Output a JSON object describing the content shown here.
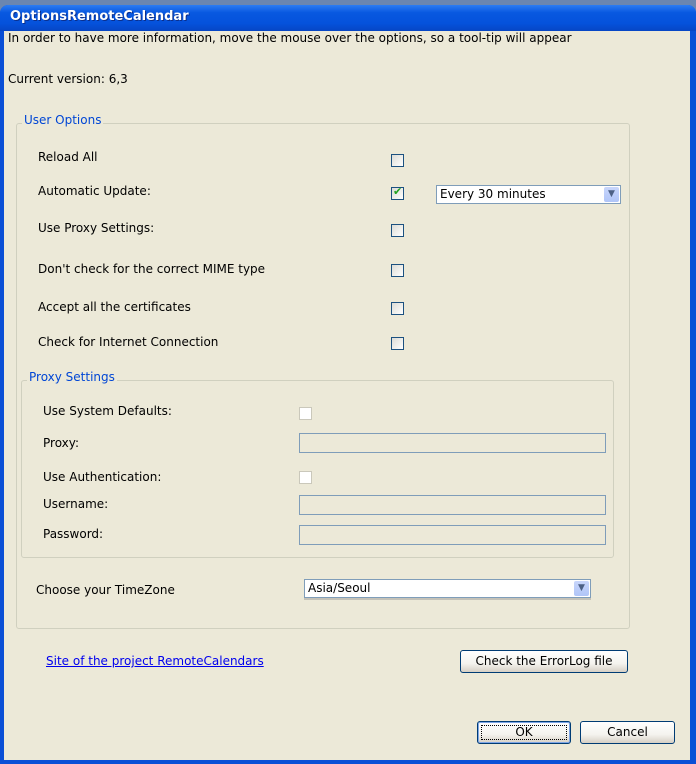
{
  "window": {
    "title": "OptionsRemoteCalendar"
  },
  "intro_text": "In order to have more information, move the mouse over the options, so a tool-tip will appear",
  "version_text": "Current version: 6,3",
  "user_options": {
    "label": "User Options",
    "items": [
      {
        "label": "Reload All",
        "checked": false
      },
      {
        "label": "Automatic Update:",
        "checked": true
      },
      {
        "label": "Use Proxy Settings:",
        "checked": false
      },
      {
        "label": "Don't check for the correct MIME type",
        "checked": false
      },
      {
        "label": "Accept all the certificates",
        "checked": false
      },
      {
        "label": "Check for Internet Connection",
        "checked": false
      }
    ],
    "update_interval": {
      "selected": "Every 30 minutes"
    }
  },
  "proxy_settings": {
    "label": "Proxy Settings",
    "use_system_defaults_label": "Use System Defaults:",
    "proxy_label": "Proxy:",
    "proxy_value": "",
    "use_authentication_label": "Use Authentication:",
    "username_label": "Username:",
    "username_value": "",
    "password_label": "Password:",
    "password_value": ""
  },
  "timezone": {
    "label": "Choose your TimeZone",
    "selected": "Asia/Seoul"
  },
  "project_link": "Site of the project RemoteCalendars",
  "errorlog_button": "Check the ErrorLog file",
  "ok_button": "OK",
  "cancel_button": "Cancel"
}
